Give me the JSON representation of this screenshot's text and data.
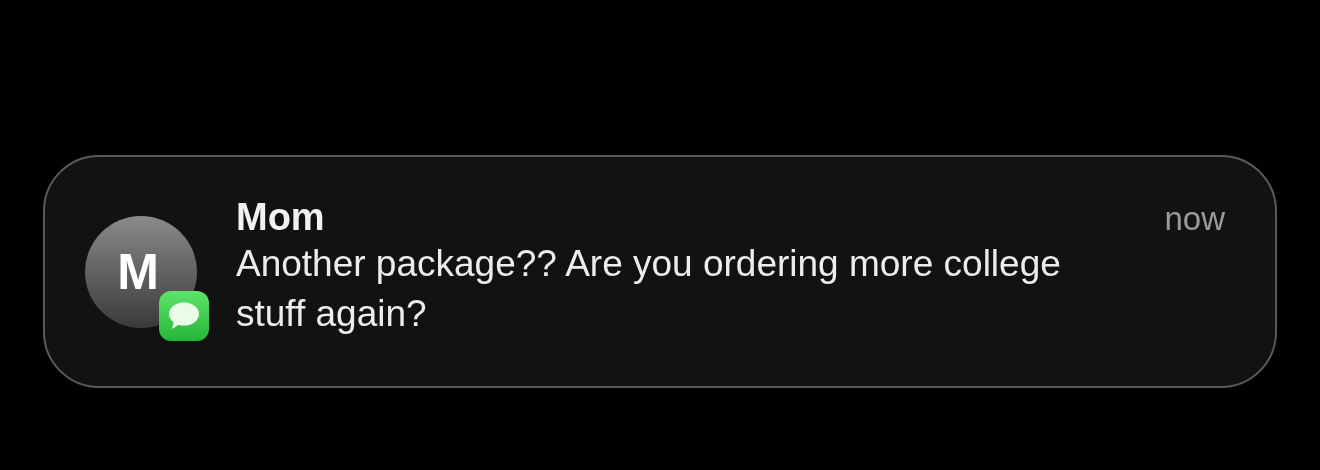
{
  "notification": {
    "avatar_initial": "M",
    "sender": "Mom",
    "time": "now",
    "message": "Another package?? Are you ordering more college stuff again?"
  }
}
